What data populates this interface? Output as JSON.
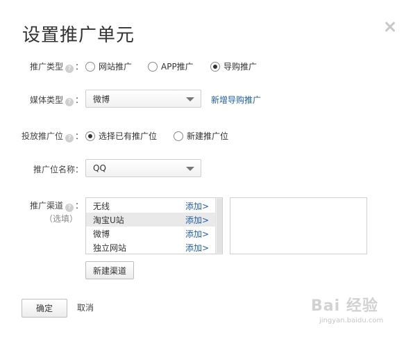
{
  "dialog": {
    "title": "设置推广单元",
    "close_icon": "close-icon"
  },
  "promo_type": {
    "label": "推广类型",
    "options": [
      {
        "label": "网站推广",
        "selected": false
      },
      {
        "label": "APP推广",
        "selected": false
      },
      {
        "label": "导购推广",
        "selected": true
      }
    ]
  },
  "media_type": {
    "label": "媒体类型",
    "value": "微博",
    "link": "新增导购推广"
  },
  "placement": {
    "label": "投放推广位",
    "options": [
      {
        "label": "选择已有推广位",
        "selected": true
      },
      {
        "label": "新建推广位",
        "selected": false
      }
    ]
  },
  "placement_name": {
    "label": "推广位名称",
    "value": "QQ"
  },
  "channel": {
    "label": "推广渠道",
    "optional": "（选填）",
    "items": [
      {
        "name": "无线",
        "add": "添加>"
      },
      {
        "name": "淘宝U站",
        "add": "添加>"
      },
      {
        "name": "微博",
        "add": "添加>"
      },
      {
        "name": "独立网站",
        "add": "添加>"
      }
    ],
    "selected_index": 1,
    "new_button": "新建渠道"
  },
  "footer": {
    "confirm": "确定",
    "cancel": "取消"
  },
  "watermark": {
    "brand": "Bai 经验",
    "url": "jingyan.baidu.com"
  },
  "colors": {
    "link": "#1f5ea8",
    "border": "#cfcfcf",
    "selected_row": "#e9e9e9"
  }
}
